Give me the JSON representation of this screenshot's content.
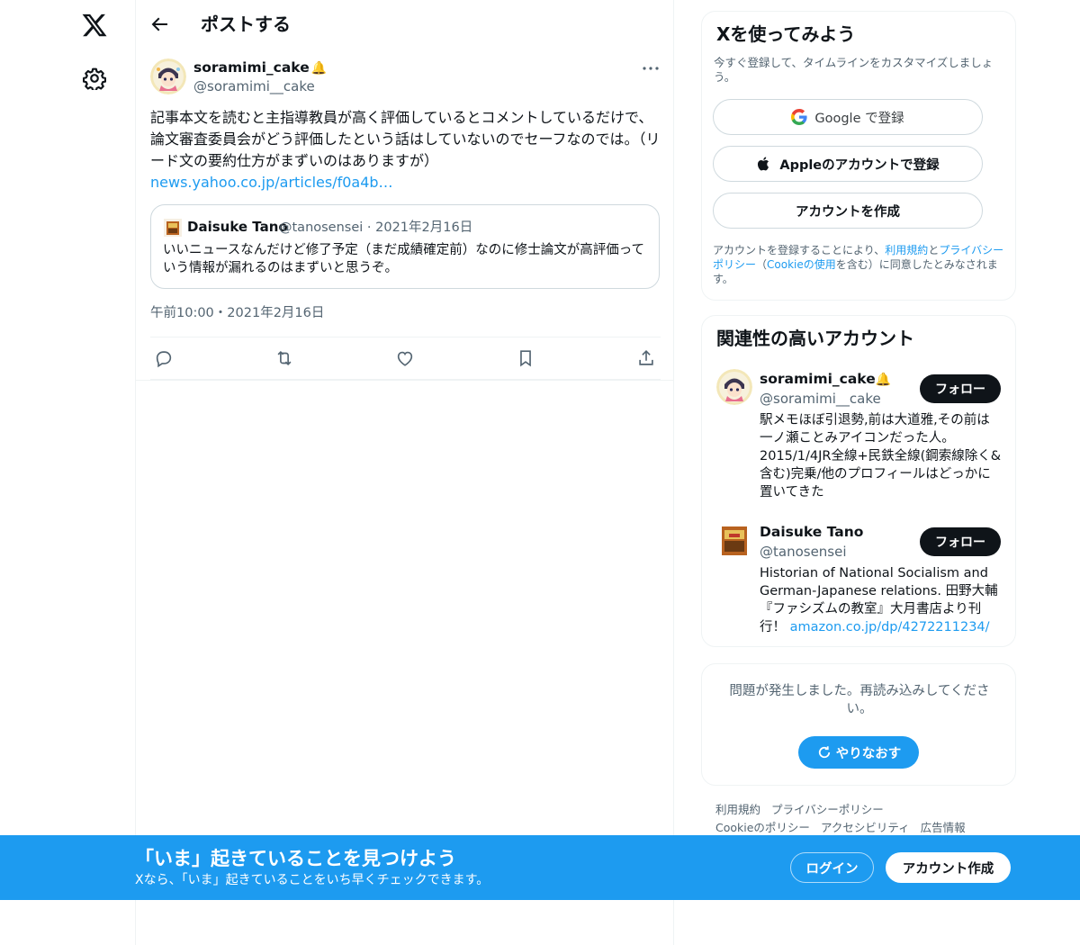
{
  "nav": {
    "logo_icon": "x-logo-icon",
    "settings_icon": "gear-icon"
  },
  "header": {
    "title": "ポストする",
    "back_icon": "arrow-left-icon"
  },
  "post": {
    "author_name": "soramimi_cake",
    "author_badge": "🔔",
    "author_handle": "@soramimi__cake",
    "text": "記事本文を読むと主指導教員が高く評価しているとコメントしているだけで、論文審査委員会がどう評価したという話はしていないのでセーフなのでは。（リード文の要約仕方がまずいのはありますが）",
    "link": "news.yahoo.co.jp/articles/f0a4b…",
    "timestamp": "午前10:00・2021年2月16日",
    "quote": {
      "author_name": "Daisuke Tano",
      "meta": "@tanosensei · 2021年2月16日",
      "text": "いいニュースなんだけど修了予定（まだ成績確定前）なのに修士論文が高評価っていう情報が漏れるのはまずいと思うぞ。"
    },
    "actions": [
      "reply-icon",
      "repost-icon",
      "like-icon",
      "bookmark-icon",
      "share-icon"
    ]
  },
  "signup_card": {
    "title": "Xを使ってみよう",
    "subtitle": "今すぐ登録して、タイムラインをカスタマイズしましょう。",
    "google_label": "Google で登録",
    "apple_label": "Appleのアカウントで登録",
    "create_label": "アカウントを作成",
    "legal_1": "アカウントを登録することにより、",
    "legal_terms": "利用規約",
    "legal_2": "と",
    "legal_privacy": "プライバシーポリシー",
    "legal_3": "（",
    "legal_cookie": "Cookieの使用",
    "legal_4": "を含む）に同意したとみなされます。"
  },
  "related": {
    "title": "関連性の高いアカウント",
    "accounts": [
      {
        "name": "soramimi_cake",
        "badge": "🔔",
        "handle": "@soramimi__cake",
        "bio": "駅メモほぼ引退勢,前は大道雅,その前は一ノ瀬ことみアイコンだった人。2015/1/4JR全線+民鉄全線(鋼索線除く&含む)完乗/他のプロフィールはどっかに置いてきた",
        "follow_label": "フォロー"
      },
      {
        "name": "Daisuke Tano",
        "handle": "@tanosensei",
        "bio": "Historian of National Socialism and German-Japanese relations. 田野大輔『ファシズムの教室』大月書店より刊行！ ",
        "bio_link": "amazon.co.jp/dp/4272211234/",
        "follow_label": "フォロー"
      }
    ]
  },
  "error_card": {
    "message": "問題が発生しました。再読み込みしてください。",
    "retry_label": "やりなおす"
  },
  "footer": {
    "links": [
      "利用規約",
      "プライバシーポリシー",
      "Cookieのポリシー",
      "アクセシビリティ",
      "広告情報"
    ]
  },
  "bottom_bar": {
    "title": "「いま」起きていることを見つけよう",
    "subtitle": "Xなら、「いま」起きていることをいち早くチェックできます。",
    "login_label": "ログイン",
    "signup_label": "アカウント作成"
  },
  "colors": {
    "accent": "#1d9bf0",
    "text": "#0f1419",
    "muted": "#536471",
    "border": "#cfd9de"
  }
}
